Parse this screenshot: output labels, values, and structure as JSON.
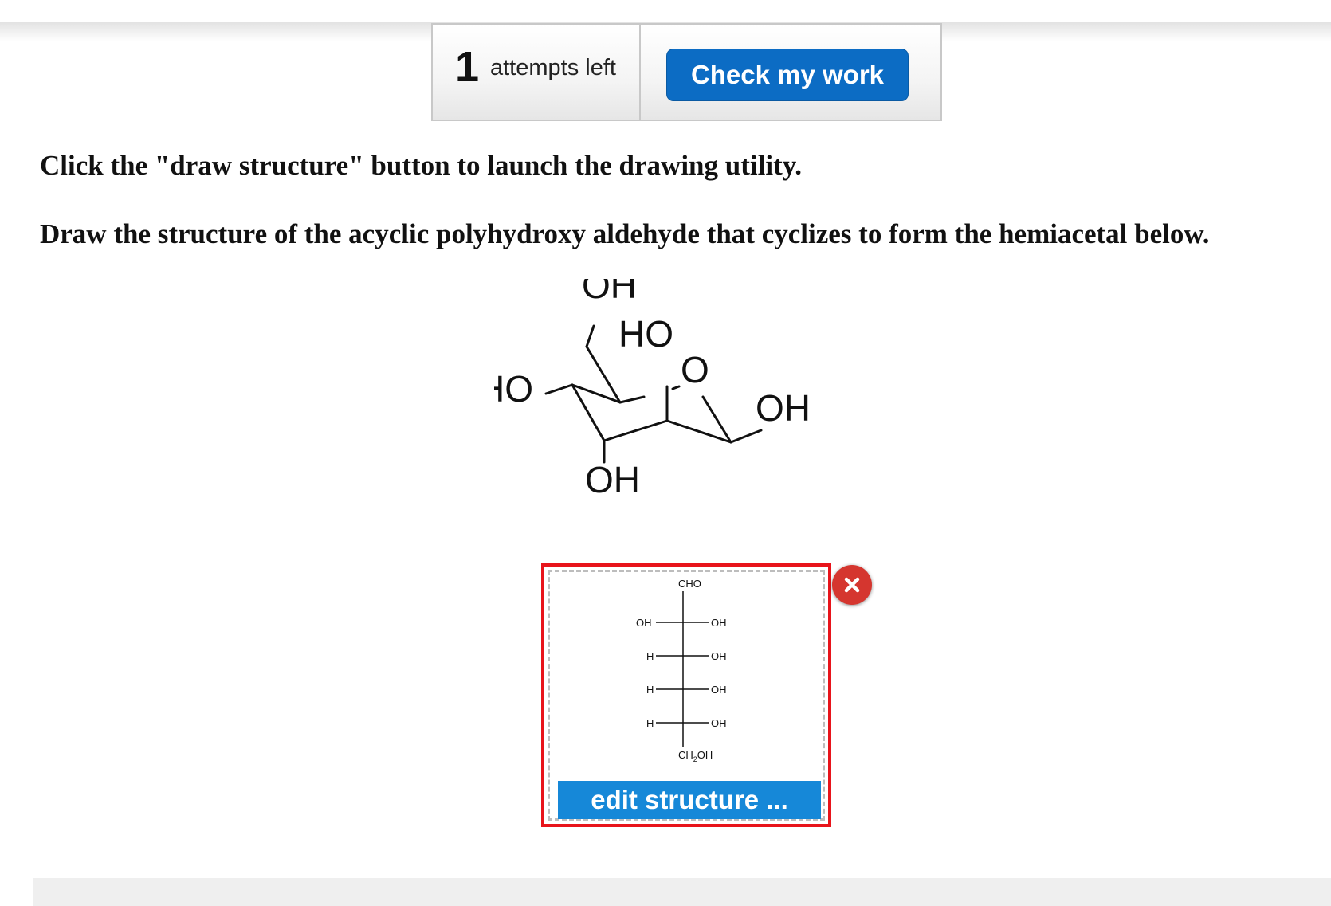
{
  "attempts": {
    "count": "1",
    "label": "attempts left"
  },
  "check_button": {
    "label": "Check my work"
  },
  "instructions": [
    "Click the \"draw structure\" button to launch the drawing utility.",
    "Draw the structure of the acyclic polyhydroxy aldehyde that cyclizes to form the hemiacetal below."
  ],
  "hemiacetal": {
    "labels": {
      "ch2oh_oh": "OH",
      "c4_ho": "HO",
      "ring_o": "O",
      "c3_ho": "HO",
      "anomeric_oh": "OH",
      "c2_oh": "OH"
    }
  },
  "answer": {
    "fischer": {
      "top": "CHO",
      "rows": [
        {
          "left": "OH",
          "right": "OH"
        },
        {
          "left": "H",
          "right": "OH"
        },
        {
          "left": "H",
          "right": "OH"
        },
        {
          "left": "H",
          "right": "OH"
        }
      ],
      "bottom_main": "CH",
      "bottom_sub": "2",
      "bottom_tail": "OH"
    },
    "edit_button": {
      "label": "edit structure ..."
    },
    "remove_icon": "close-icon"
  },
  "colors": {
    "check_button": "#0c6cc4",
    "edit_button": "#1688d8",
    "answer_border": "#e8141b",
    "remove_icon": "#d5362f"
  }
}
